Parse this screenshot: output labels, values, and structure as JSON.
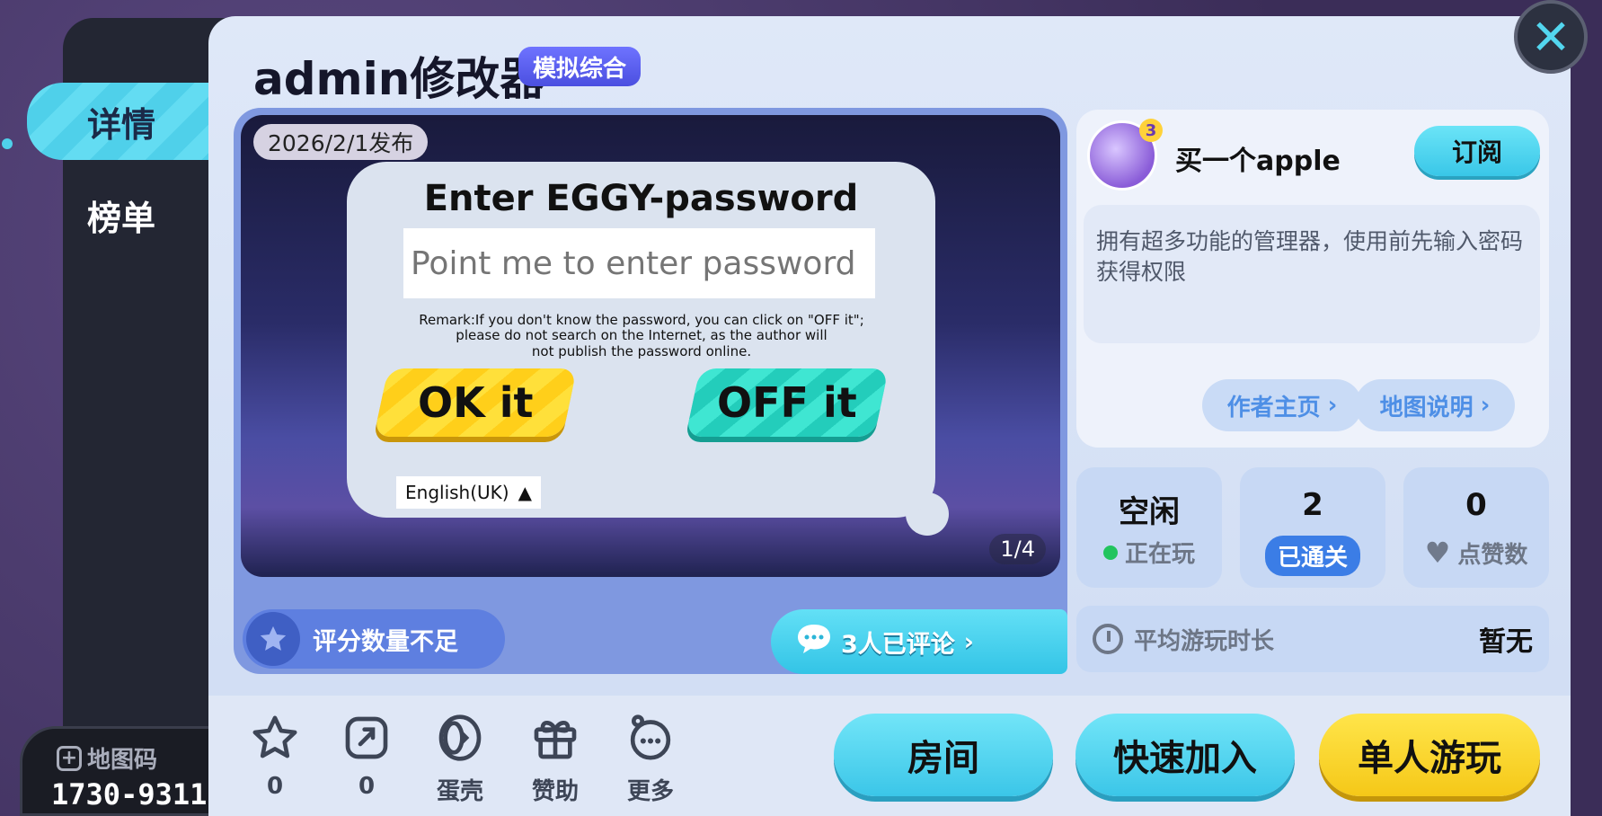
{
  "sidebar": {
    "tabs": [
      {
        "label": "详情"
      },
      {
        "label": "榜单"
      }
    ],
    "map_code_label": "地图码",
    "map_code": "1730-9311"
  },
  "header": {
    "title": "admin修改器",
    "tag": "模拟综合"
  },
  "media": {
    "publish_date": "2026/2/1发布",
    "page_indicator": "1/4",
    "dialog_title": "Enter EGGY-password",
    "password_placeholder": "Point me to enter password",
    "remark_lines": [
      "Remark:If you don't know the password, you can click on \"OFF it\";",
      "please do not search on the Internet, as the author will",
      "not publish the password online."
    ],
    "ok_label": "OK it",
    "off_label": "OFF it",
    "language": "English(UK)",
    "language_arrow": "▲"
  },
  "rating": {
    "text": "评分数量不足"
  },
  "comments": {
    "text": "3人已评论"
  },
  "author": {
    "avatar_badge": "3",
    "name": "买一个apple",
    "subscribe_label": "订阅",
    "description": "拥有超多功能的管理器，使用前先输入密码获得权限",
    "author_page_label": "作者主页",
    "map_info_label": "地图说明"
  },
  "stats": [
    {
      "value": "空闲",
      "label": "正在玩"
    },
    {
      "value": "2",
      "label": "已通关"
    },
    {
      "value": "0",
      "label": "点赞数"
    }
  ],
  "avg_playtime": {
    "label": "平均游玩时长",
    "value": "暂无"
  },
  "bottom_actions": [
    {
      "icon": "star-icon",
      "label": "0"
    },
    {
      "icon": "share-icon",
      "label": "0"
    },
    {
      "icon": "eggshell-icon",
      "label": "蛋壳"
    },
    {
      "icon": "gift-icon",
      "label": "赞助"
    },
    {
      "icon": "more-icon",
      "label": "更多"
    }
  ],
  "buttons": {
    "room": "房间",
    "quick_join": "快速加入",
    "solo": "单人游玩"
  },
  "colors": {
    "accent_cyan": "#3bc6e8",
    "accent_yellow": "#f5c818",
    "tag_purple": "#4b4fe0",
    "status_green": "#22c45e"
  }
}
